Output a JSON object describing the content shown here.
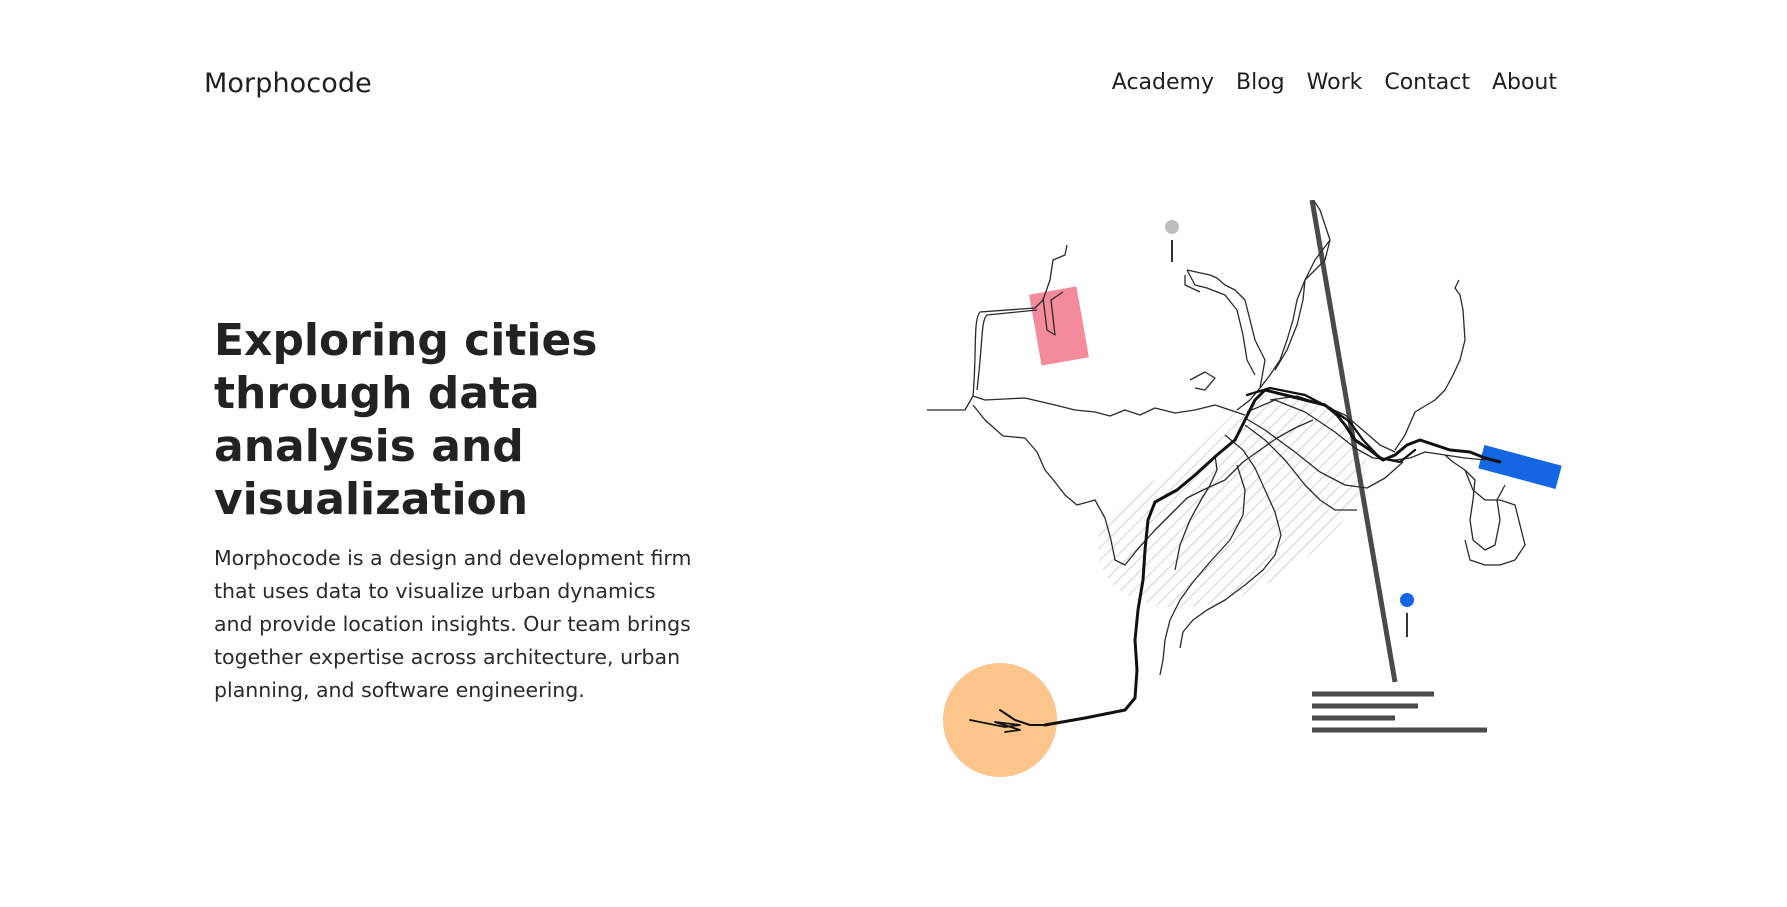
{
  "brand": {
    "name": "Morphocode"
  },
  "nav": {
    "items": [
      {
        "label": "Academy"
      },
      {
        "label": "Blog"
      },
      {
        "label": "Work"
      },
      {
        "label": "Contact"
      },
      {
        "label": "About"
      }
    ]
  },
  "hero": {
    "title": "Exploring cities through data analysis and visualization",
    "description": "Morphocode is a design and development firm that uses data to visualize urban dynamics and provide location insights. Our team brings together expertise across architecture, urban planning, and software engineering."
  },
  "illustration": {
    "colors": {
      "pink": "#f48b9c",
      "blue": "#1566e3",
      "orange": "#fbc58c",
      "gray_pin": "#bdbdbd",
      "hatch": "#c8c8c8",
      "lines": "#1a1a1a"
    }
  }
}
